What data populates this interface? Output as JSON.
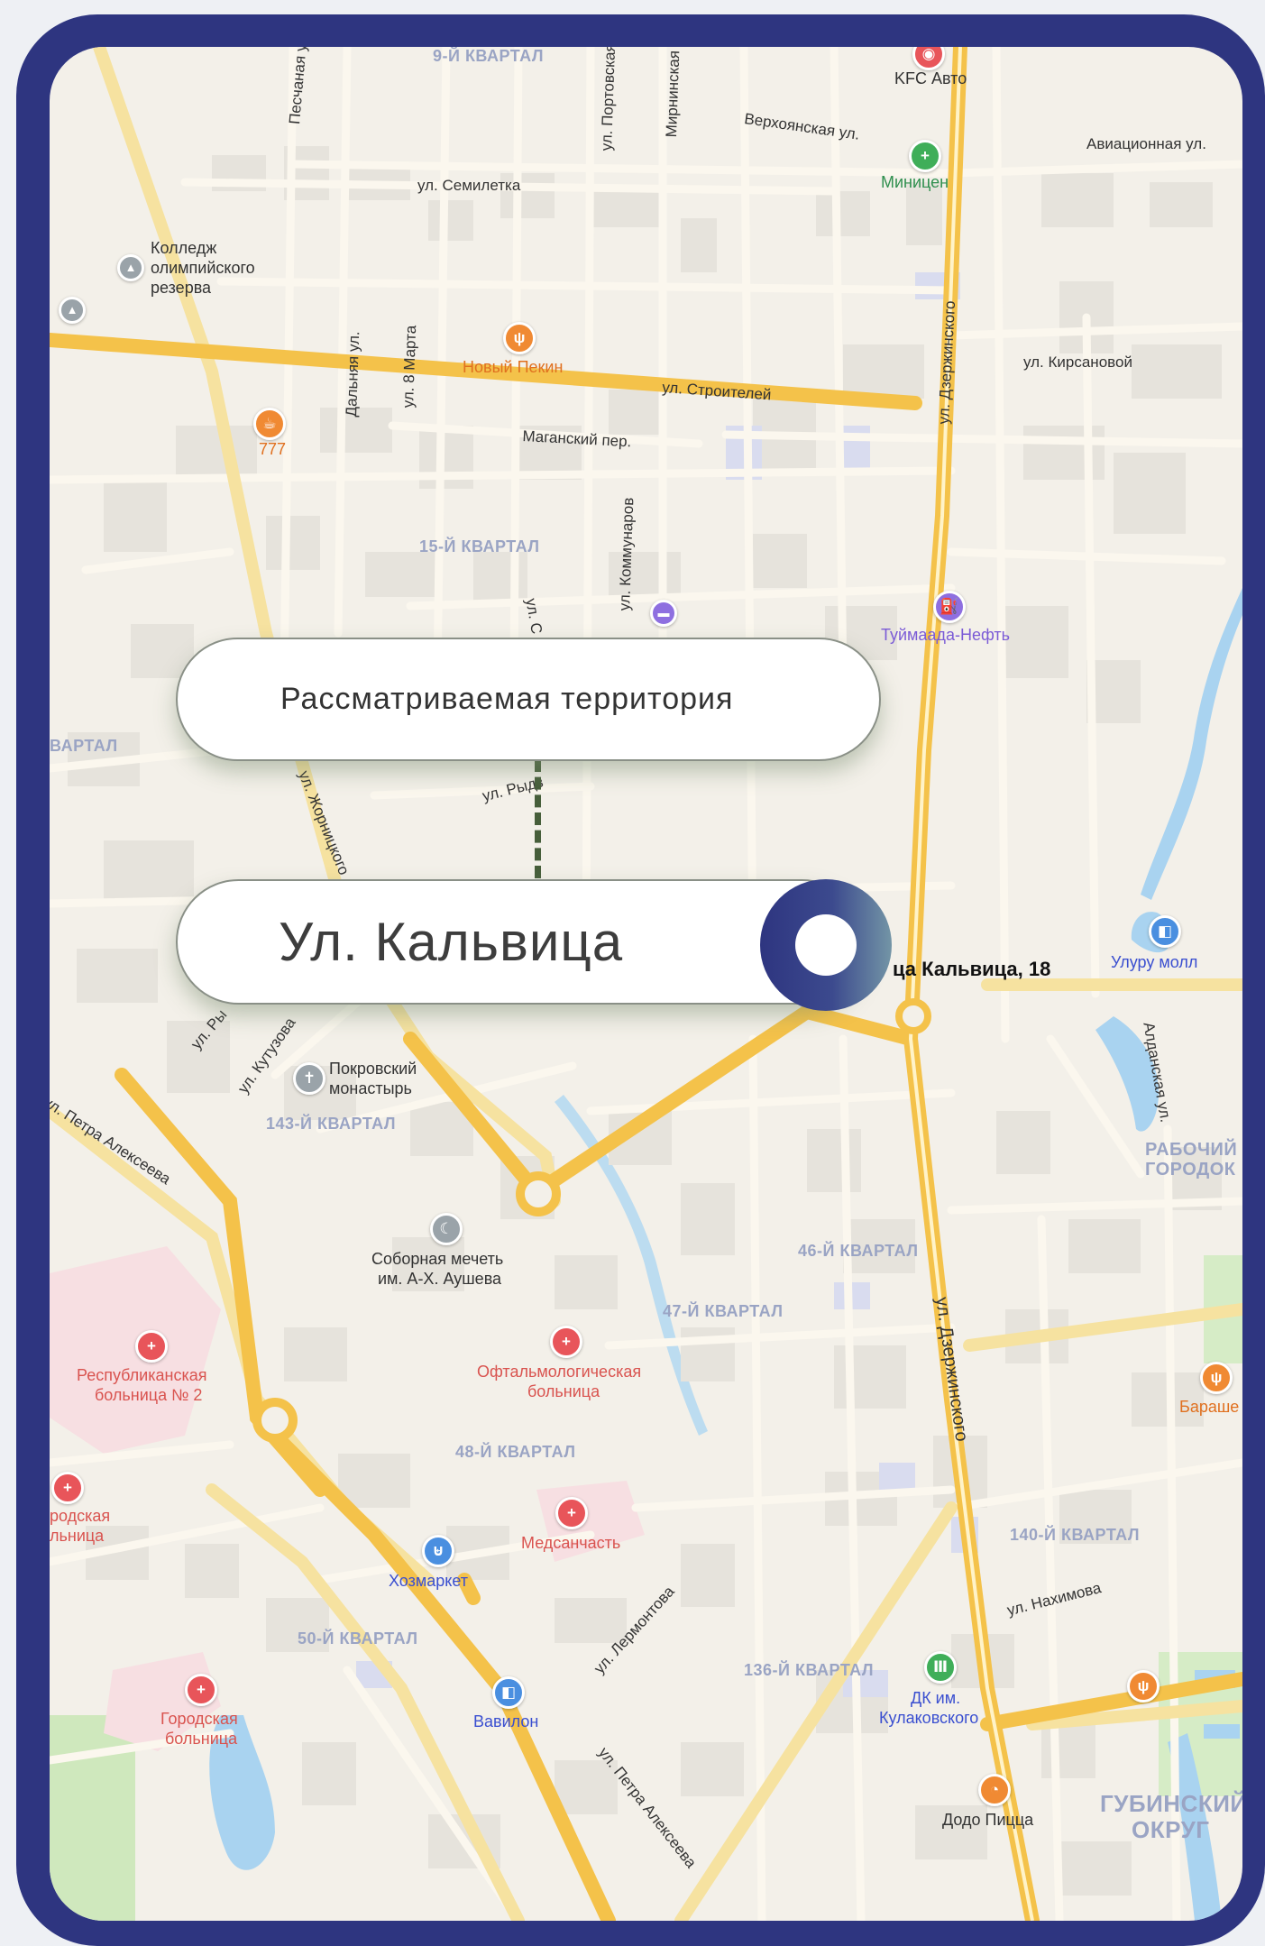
{
  "markers": {
    "territory_label": "Рассматриваемая  территория",
    "street_label": "Ул. Кальвица"
  },
  "map": {
    "address": "ца Кальвица, 18",
    "quarters": [
      "9-Й КВАРТАЛ",
      "15-Й КВАРТАЛ",
      "ВАРТАЛ",
      "143-Й КВАРТАЛ",
      "46-Й КВАРТАЛ",
      "47-Й КВАРТАЛ",
      "48-Й КВАРТАЛ",
      "50-Й КВАРТАЛ",
      "136-Й КВАРТАЛ",
      "140-Й КВАРТАЛ"
    ],
    "districts": [
      "РАБОЧИЙ",
      "ГОРОДОК",
      "ГУБИНСКИЙ",
      "ОКРУГ"
    ],
    "streets": [
      "ул. Семилетка",
      "Песчаная ул.",
      "ул. Портовская",
      "Мирнинская",
      "Верхоянская ул.",
      "Авиационная ул.",
      "Дальняя ул.",
      "ул. 8 Марта",
      "ул. Строителей",
      "Маганский пер.",
      "ул. Коммунаров",
      "ул. Дзержинского",
      "ул. Кирсановой",
      "ул. С",
      "ул. Жорницкого",
      "ул. Рыдз",
      "ул. Ры",
      "ул. Кутузова",
      "ул. Петра Алексеева",
      "Алданская ул.",
      "ул. Дзержинского",
      "ул. Лермонтова",
      "ул. Нахимова",
      "ул. Петра Алексеева"
    ],
    "pois": {
      "kfc": "KFC Авто",
      "minicen": "Миницен",
      "college": [
        "Колледж",
        "олимпийского",
        "резерва"
      ],
      "peking": "Новый Пекин",
      "cafe777": "777",
      "tuymaada": "Туймаада-Нефть",
      "ulurumoll": "Улуру молл",
      "monastery": [
        "Покровский",
        "монастырь"
      ],
      "mosque": [
        "Соборная мечеть",
        "им. А-Х. Аушева"
      ],
      "republic_hospital": [
        "Республиканская",
        "больница № 2"
      ],
      "ophthalmo": [
        "Офтальмологическая",
        "больница"
      ],
      "city_hosp_left": [
        "родская",
        "льница"
      ],
      "medsanchast": "Медсанчасть",
      "hozmarket": "Хозмаркет",
      "city_hospital": [
        "Городская",
        "больница"
      ],
      "vavilon": "Вавилон",
      "dk": [
        "ДК им.",
        "Кулаковского"
      ],
      "dodo": "Додо Пицца",
      "barashek": "Бараше"
    }
  },
  "colors": {
    "frame": "#2e3580",
    "road_major": "#f7c94d",
    "road_minor": "#f6e2a0",
    "water": "#a9d3f0",
    "park": "#cfe8bd",
    "hospital": "#f4d0d5",
    "pin_red": "#e8555a",
    "pin_orange": "#f08a33",
    "pin_green": "#3fae59",
    "pin_blue": "#4a8fe0",
    "pin_purple": "#8e6fe0",
    "dashed_line": "#465e3a"
  }
}
